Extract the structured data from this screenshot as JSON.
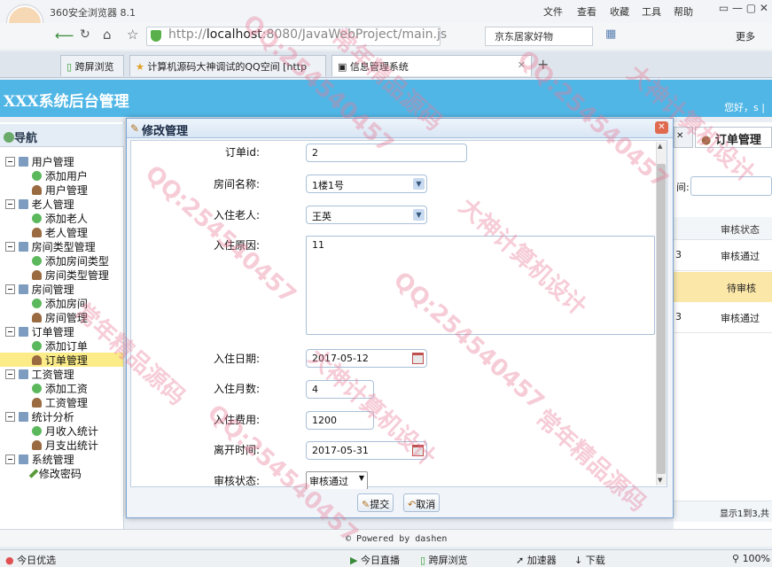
{
  "browser": {
    "app_title": "360安全浏览器 8.1",
    "menus": [
      "文件",
      "查看",
      "收藏",
      "工具",
      "帮助"
    ],
    "url_prefix": "http://",
    "url_host": "localhost",
    "url_rest": ":8080/JavaWebProject/main.js",
    "search_text": "京东居家好物",
    "tabs": [
      "跨屏浏览",
      "计算机源码大神调试的QQ空间 [http",
      "信息管理系统"
    ],
    "right_label": "更多"
  },
  "header": {
    "title": "XXX系统后台管理",
    "hello": "您好，s |"
  },
  "nav": {
    "title": "导航",
    "groups": [
      {
        "label": "用户管理",
        "items": [
          "添加用户",
          "用户管理"
        ]
      },
      {
        "label": "老人管理",
        "items": [
          "添加老人",
          "老人管理"
        ]
      },
      {
        "label": "房间类型管理",
        "items": [
          "添加房间类型",
          "房间类型管理"
        ]
      },
      {
        "label": "房间管理",
        "items": [
          "添加房间",
          "房间管理"
        ]
      },
      {
        "label": "订单管理",
        "items": [
          "添加订单",
          "订单管理"
        ]
      },
      {
        "label": "工资管理",
        "items": [
          "添加工资",
          "工资管理"
        ]
      },
      {
        "label": "统计分析",
        "items": [
          "月收入统计",
          "月支出统计"
        ]
      },
      {
        "label": "系统管理",
        "items": [
          "修改密码"
        ]
      }
    ],
    "selected": "订单管理"
  },
  "main": {
    "tab_label": "订单管理",
    "filter_label": "间:",
    "column": "审核状态",
    "rows": [
      {
        "cell": "3",
        "status": "审核通过"
      },
      {
        "cell": "",
        "status": "待审核"
      },
      {
        "cell": "3",
        "status": "审核通过"
      }
    ],
    "pager": "显示1到3,共"
  },
  "dialog": {
    "title": "修改管理",
    "fields": {
      "order_id": {
        "label": "订单id:",
        "value": "2"
      },
      "room": {
        "label": "房间名称:",
        "value": "1楼1号"
      },
      "elder": {
        "label": "入住老人:",
        "value": "王英"
      },
      "reason": {
        "label": "入住原因:",
        "value": "11"
      },
      "start_date": {
        "label": "入住日期:",
        "value": "2017-05-12"
      },
      "months": {
        "label": "入住月数:",
        "value": "4"
      },
      "fee": {
        "label": "入住费用:",
        "value": "1200"
      },
      "leave_date": {
        "label": "离开时间:",
        "value": "2017-05-31"
      },
      "status": {
        "label": "审核状态:",
        "value": "审核通过"
      }
    },
    "submit": "提交",
    "cancel": "取消"
  },
  "footer": {
    "powered": "© Powered by dashen"
  },
  "statusbar": {
    "left": "今日优选",
    "live": "今日直播",
    "cross": "跨屏浏览",
    "speed": "加速器",
    "download": "下载",
    "zoom": "100%"
  },
  "watermarks": [
    "QQ:254540457",
    "大神计算机设计",
    "常年精品源码"
  ]
}
